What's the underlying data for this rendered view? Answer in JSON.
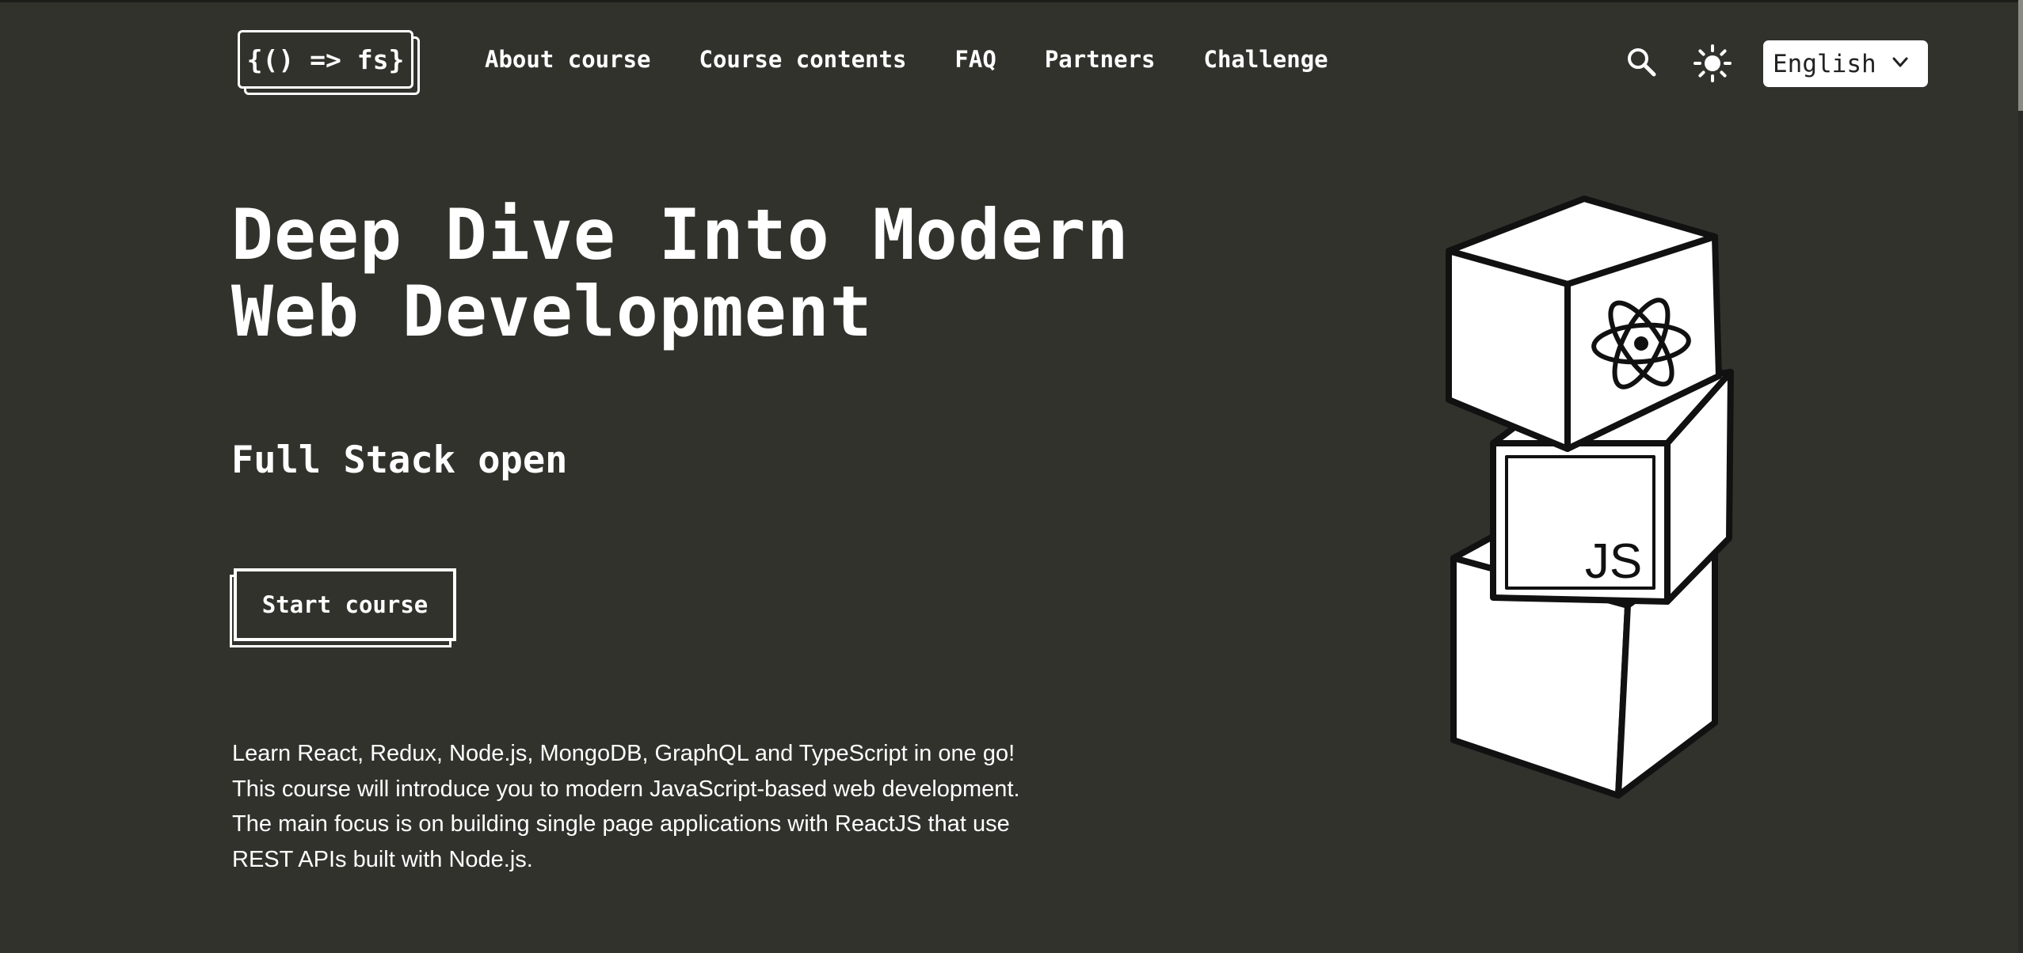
{
  "header": {
    "logo_text": "{() => fs}",
    "nav": [
      {
        "label": "About course"
      },
      {
        "label": "Course contents"
      },
      {
        "label": "FAQ"
      },
      {
        "label": "Partners"
      },
      {
        "label": "Challenge"
      }
    ],
    "search_icon": "search-icon",
    "theme_icon": "sun-icon",
    "language": {
      "selected": "English"
    }
  },
  "hero": {
    "title": "Deep Dive Into Modern\nWeb Development",
    "subtitle": "Full Stack open",
    "start_button": "Start course",
    "description": [
      "Learn React, Redux, Node.js, MongoDB, GraphQL and TypeScript in one go!",
      "This course will introduce you to modern JavaScript-based web development.",
      "The main focus is on building single page applications with ReactJS that use",
      "REST APIs built with Node.js."
    ],
    "illustration": {
      "block_label": "JS",
      "icons": [
        "react-logo-icon"
      ]
    }
  },
  "colors": {
    "background": "#32322d",
    "foreground": "#ffffff",
    "select_background": "#ffffff"
  }
}
